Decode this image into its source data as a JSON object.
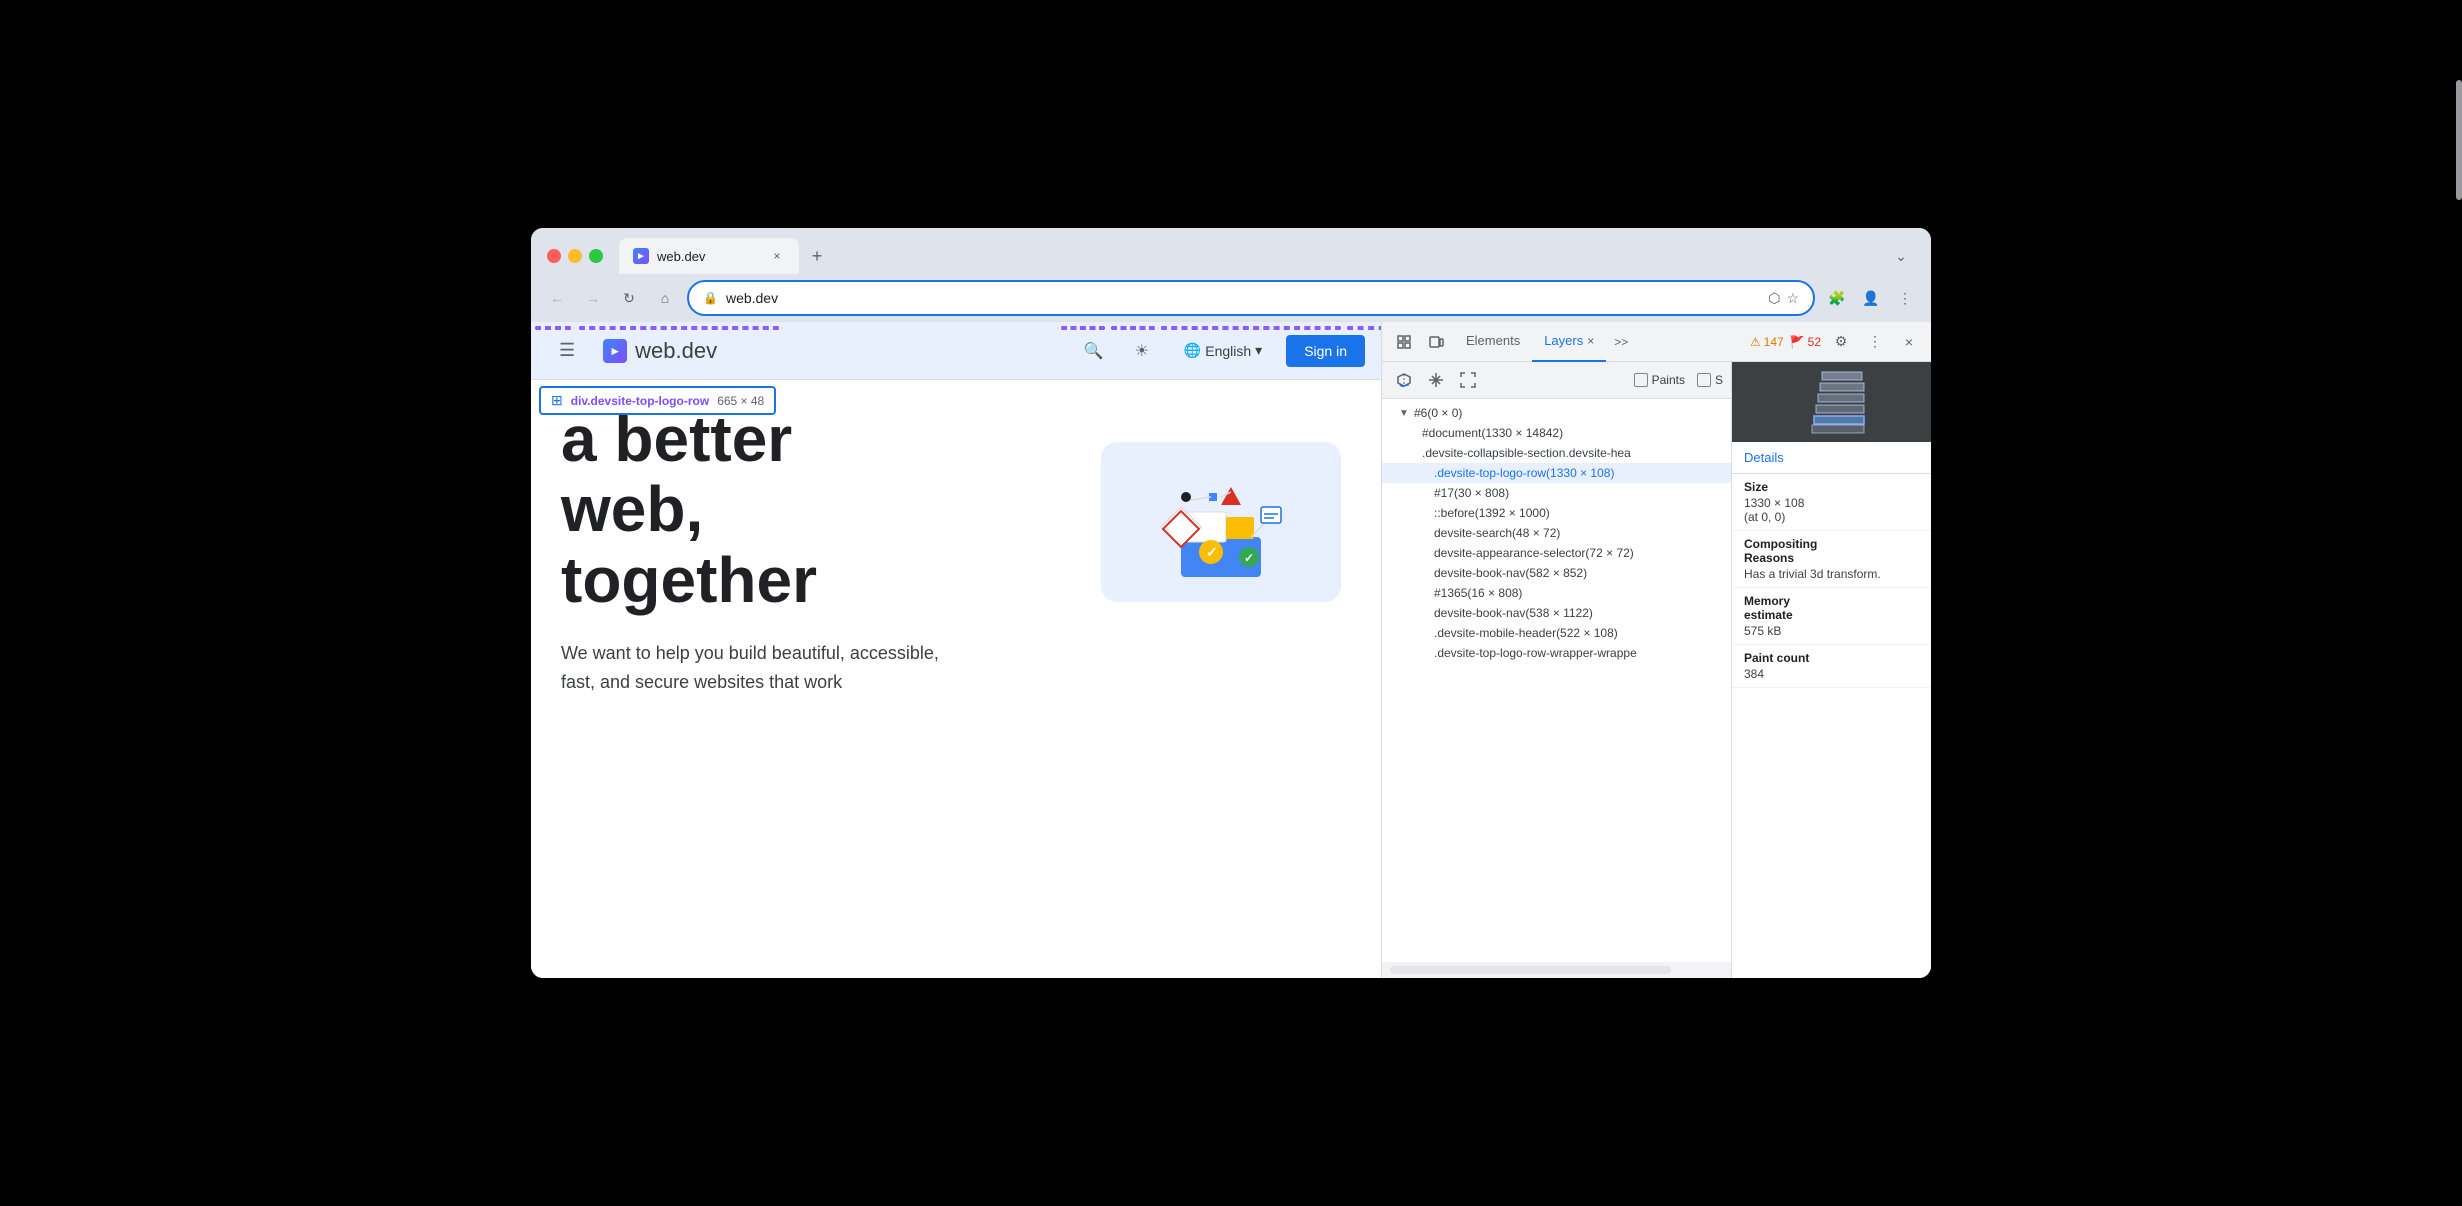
{
  "browser": {
    "tab_title": "web.dev",
    "url": "web.dev",
    "favicon_text": "►",
    "tab_close": "×",
    "new_tab": "+",
    "dropdown": "⌄"
  },
  "nav": {
    "back_label": "←",
    "forward_label": "→",
    "reload_label": "↻",
    "home_label": "⌂",
    "bookmark_label": "☆",
    "extensions_label": "🧩",
    "profile_label": "👤",
    "menu_label": "⋮",
    "new_window_label": "⬡"
  },
  "webpage": {
    "menu_icon": "☰",
    "logo_icon": "►",
    "logo_text": "web.dev",
    "search_icon": "🔍",
    "theme_icon": "☀",
    "globe_icon": "🌐",
    "lang_label": "English",
    "lang_dropdown": "▾",
    "signin_label": "Sign in",
    "element_tooltip_class": "div.devsite-top-logo-row",
    "element_tooltip_size": "665 × 48",
    "headline_line1": "a better",
    "headline_line2": "web,",
    "headline_line3": "together",
    "body_text": "We want to help you build beautiful, accessible, fast, and secure websites that work"
  },
  "devtools": {
    "tool1": "⊹",
    "tool2": "□",
    "elements_tab": "Elements",
    "layers_tab": "Layers",
    "layers_close": "×",
    "more_tabs": ">>",
    "warning_count": "147",
    "warning_icon": "⚠",
    "error_count": "52",
    "error_icon": "🚩",
    "settings_icon": "⚙",
    "more_icon": "⋮",
    "close_icon": "×"
  },
  "layers_toolbar": {
    "rotate_icon": "↻",
    "pan_icon": "✋",
    "zoom_fit_icon": "⤢",
    "paints_label": "Paints",
    "s_label": "S"
  },
  "layers_tree": {
    "items": [
      {
        "indent": 0,
        "toggle": "▼",
        "text": "#6(0 × 0)",
        "selected": false
      },
      {
        "indent": 1,
        "toggle": "",
        "text": "#document(1330 × 14842)",
        "selected": false
      },
      {
        "indent": 1,
        "toggle": "",
        "text": ".devsite-collapsible-section.devsite-hea",
        "selected": false
      },
      {
        "indent": 2,
        "toggle": "",
        "text": ".devsite-top-logo-row(1330 × 108)",
        "selected": true
      },
      {
        "indent": 2,
        "toggle": "",
        "text": "#17(30 × 808)",
        "selected": false
      },
      {
        "indent": 2,
        "toggle": "",
        "text": "::before(1392 × 1000)",
        "selected": false
      },
      {
        "indent": 2,
        "toggle": "",
        "text": "devsite-search(48 × 72)",
        "selected": false
      },
      {
        "indent": 2,
        "toggle": "",
        "text": "devsite-appearance-selector(72 × 72)",
        "selected": false
      },
      {
        "indent": 2,
        "toggle": "",
        "text": "devsite-book-nav(582 × 852)",
        "selected": false
      },
      {
        "indent": 2,
        "toggle": "",
        "text": "#1365(16 × 808)",
        "selected": false
      },
      {
        "indent": 2,
        "toggle": "",
        "text": "devsite-book-nav(538 × 1122)",
        "selected": false
      },
      {
        "indent": 2,
        "toggle": "",
        "text": ".devsite-mobile-header(522 × 108)",
        "selected": false
      },
      {
        "indent": 2,
        "toggle": "",
        "text": ".devsite-top-logo-row-wrapper-wrappe",
        "selected": false
      }
    ]
  },
  "details": {
    "header": "Details",
    "size_label": "Size",
    "size_value": "1330 × 108\n(at 0, 0)",
    "compositing_label": "Compositing\nReasons",
    "compositing_value": "Has a trivial 3d transform.",
    "memory_label": "Memory\nestimate",
    "memory_value": "575 kB",
    "paint_count_label": "Paint count",
    "paint_count_value": "384"
  }
}
